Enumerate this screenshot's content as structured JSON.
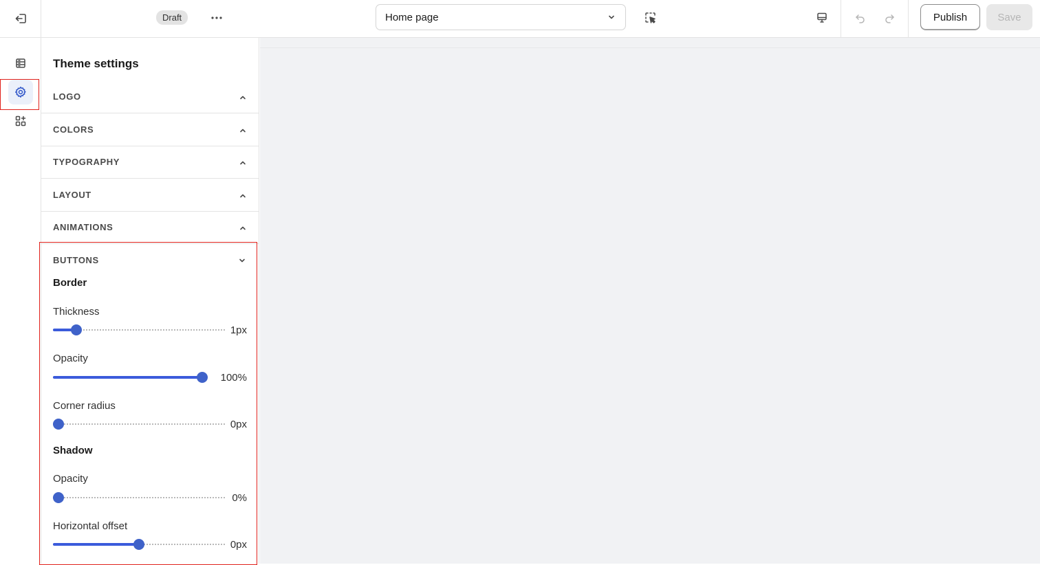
{
  "topbar": {
    "status_badge": "Draft",
    "page_selector": "Home page",
    "publish_label": "Publish",
    "save_label": "Save"
  },
  "panel": {
    "title": "Theme settings",
    "sections": [
      {
        "label": "LOGO",
        "icon": "chevron-up-icon"
      },
      {
        "label": "COLORS",
        "icon": "chevron-up-icon"
      },
      {
        "label": "TYPOGRAPHY",
        "icon": "chevron-up-icon"
      },
      {
        "label": "LAYOUT",
        "icon": "chevron-up-icon"
      },
      {
        "label": "ANIMATIONS",
        "icon": "chevron-up-icon"
      }
    ],
    "buttons": {
      "label": "BUTTONS",
      "border": {
        "heading": "Border",
        "thickness": {
          "label": "Thickness",
          "value": "1px",
          "level": 0.11
        },
        "opacity": {
          "label": "Opacity",
          "value": "100%",
          "level": 1.0
        },
        "corner_radius": {
          "label": "Corner radius",
          "value": "0px",
          "level": 0.0
        }
      },
      "shadow": {
        "heading": "Shadow",
        "opacity": {
          "label": "Opacity",
          "value": "0%",
          "level": 0.0
        },
        "horizontal_offset": {
          "label": "Horizontal offset",
          "value": "0px",
          "level": 0.5
        }
      }
    }
  },
  "colors": {
    "accent": "#3f62c9",
    "highlight": "#e0201a",
    "preview_bg": "#f1f2f4"
  }
}
